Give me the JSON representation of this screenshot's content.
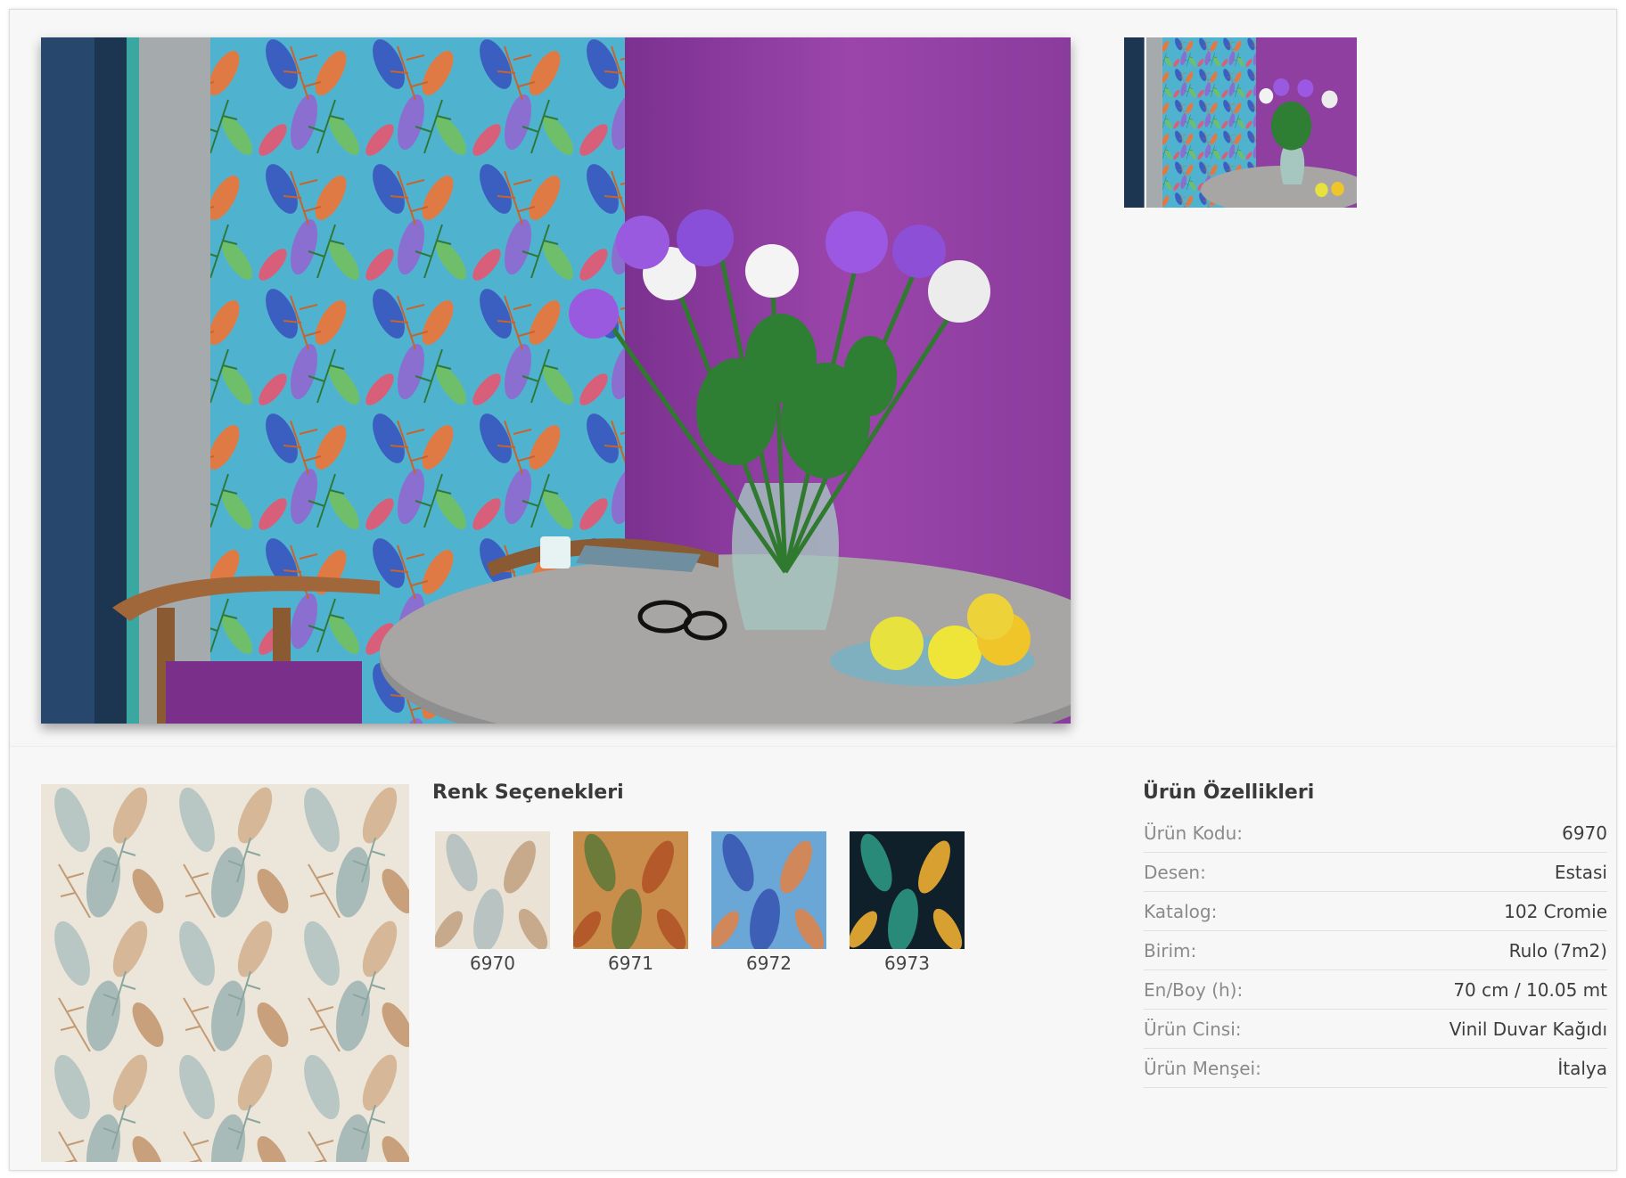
{
  "gallery": {
    "main_image_alt": "",
    "thumbnails": [
      {
        "alt": ""
      }
    ]
  },
  "color_options": {
    "title": "Renk Seçenekleri",
    "items": [
      {
        "code": "6970",
        "palette": [
          "#e9e2d5",
          "#b9c4c2",
          "#c7a98c"
        ]
      },
      {
        "code": "6971",
        "palette": [
          "#c98e4c",
          "#6c7a3a",
          "#b45a2a"
        ]
      },
      {
        "code": "6972",
        "palette": [
          "#6aa6d6",
          "#3d5fb5",
          "#d0875a"
        ]
      },
      {
        "code": "6973",
        "palette": [
          "#10202a",
          "#2a8a7a",
          "#d8a030"
        ]
      }
    ]
  },
  "product_specs": {
    "title": "Ürün Özellikleri",
    "rows": [
      {
        "key": "Ürün Kodu:",
        "value": "6970"
      },
      {
        "key": "Desen:",
        "value": "Estasi"
      },
      {
        "key": "Katalog:",
        "value": "102 Cromie"
      },
      {
        "key": "Birim:",
        "value": "Rulo (7m2)"
      },
      {
        "key": "En/Boy (h):",
        "value": "70 cm / 10.05 mt"
      },
      {
        "key": "Ürün Cinsi:",
        "value": "Vinil Duvar Kağıdı"
      },
      {
        "key": "Ürün Menşei:",
        "value": "İtalya"
      }
    ]
  },
  "colors": {
    "background": "#f7f7f7",
    "purple_wall": "#8e3fa0",
    "table_top": "#8f8f8f"
  }
}
